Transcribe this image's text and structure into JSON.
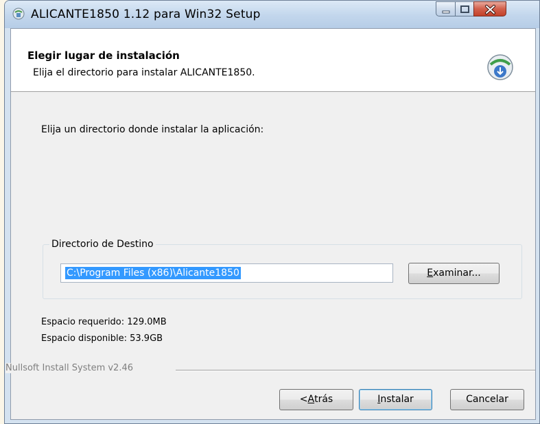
{
  "window": {
    "title": "ALICANTE1850 1.12 para Win32 Setup",
    "controls": [
      "minimize-icon",
      "maximize-icon",
      "close-icon"
    ]
  },
  "header": {
    "title": "Elegir lugar de instalación",
    "subtitle": "Elija el directorio para instalar ALICANTE1850."
  },
  "main": {
    "intro": "Elija un directorio donde instalar la aplicación:",
    "destination_group": {
      "legend": "Directorio de Destino",
      "path_value": "C:\\Program Files (x86)\\Alicante1850",
      "browse_label_accel": "E",
      "browse_label_rest": "xaminar..."
    },
    "space_required": "Espacio requerido: 129.0MB",
    "space_available": "Espacio disponible: 53.9GB"
  },
  "footer": {
    "branding": "Nullsoft Install System v2.46",
    "back_prefix": "< ",
    "back_accel": "A",
    "back_rest": "trás",
    "install_accel": "I",
    "install_rest": "nstalar",
    "cancel_label": "Cancelar"
  },
  "colors": {
    "selection": "#3399ff",
    "close_button": "#c3412a",
    "titlebar": "#c2d6ec"
  }
}
